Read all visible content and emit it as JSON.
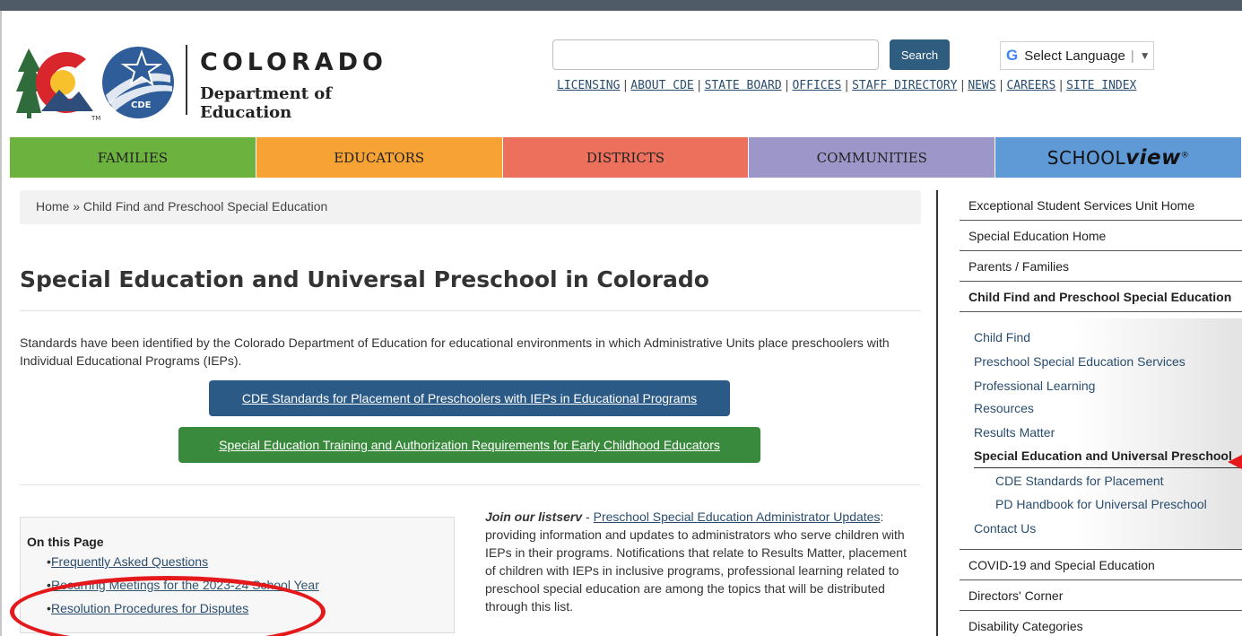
{
  "header": {
    "logo_state": "COLORADO",
    "logo_dept": "Department of Education",
    "logo_badge": "CDE",
    "logo_tm": "TM",
    "search_value": "",
    "search_button": "Search",
    "language_label": "Select Language",
    "language_g": "G",
    "language_separator": "|",
    "language_arrow": "▼",
    "util_links": [
      "LICENSING",
      "ABOUT CDE",
      "STATE BOARD",
      "OFFICES",
      "STAFF DIRECTORY",
      "NEWS",
      "CAREERS",
      "SITE INDEX"
    ],
    "util_separator": "|"
  },
  "nav": {
    "families": "FAMILIES",
    "educators": "EDUCATORS",
    "districts": "DISTRICTS",
    "communities": "COMMUNITIES",
    "schoolview_a": "SCHOOL",
    "schoolview_b": "view",
    "schoolview_mark": "®"
  },
  "breadcrumb": "Home » Child Find and Preschool Special Education",
  "main": {
    "title": "Special Education and Universal Preschool in Colorado",
    "intro": "Standards have been identified by the Colorado Department of Education for educational environments in which Administrative Units place preschoolers with Individual Educational Programs (IEPs).",
    "button_blue": "CDE Standards for Placement of Preschoolers with IEPs in Educational Programs",
    "button_green": "Special Education Training and Authorization Requirements for Early Childhood Educators",
    "on_this_page": {
      "label": "On this Page",
      "items": [
        "Frequently Asked Questions",
        "Recurring Meetings for the 2023-24 School Year",
        "Resolution Procedures for Disputes"
      ]
    },
    "listserv": {
      "join": "Join our listserv",
      "dash": " - ",
      "link": "Preschool Special Education Administrator Updates",
      "text": ": providing information and updates to administrators who serve children with IEPs in their programs. Notifications that relate to Results Matter, placement of children with IEPs in inclusive programs, professional learning related to preschool special education are among the topics that will be distributed through this list."
    }
  },
  "sidebar": {
    "top": [
      "Exceptional Student Services Unit Home",
      "Special Education Home",
      "Parents / Families",
      "Child Find and Preschool Special Education"
    ],
    "sub": [
      "Child Find",
      "Preschool Special Education Services",
      "Professional Learning",
      "Resources",
      "Results Matter",
      "Special Education and Universal Preschool"
    ],
    "sub2": [
      "CDE Standards for Placement",
      "PD Handbook for Universal Preschool"
    ],
    "contact": "Contact Us",
    "bottom": [
      "COVID-19 and Special Education",
      "Directors' Corner",
      "Disability Categories"
    ]
  },
  "colors": {
    "families": "#6cb23e",
    "educators": "#f7a235",
    "districts": "#ec705b",
    "communities": "#9d97c9",
    "schoolview": "#5f99d6",
    "button_blue": "#2c5a86",
    "button_green": "#3a8a3e",
    "annotation_red": "#e3191c"
  }
}
